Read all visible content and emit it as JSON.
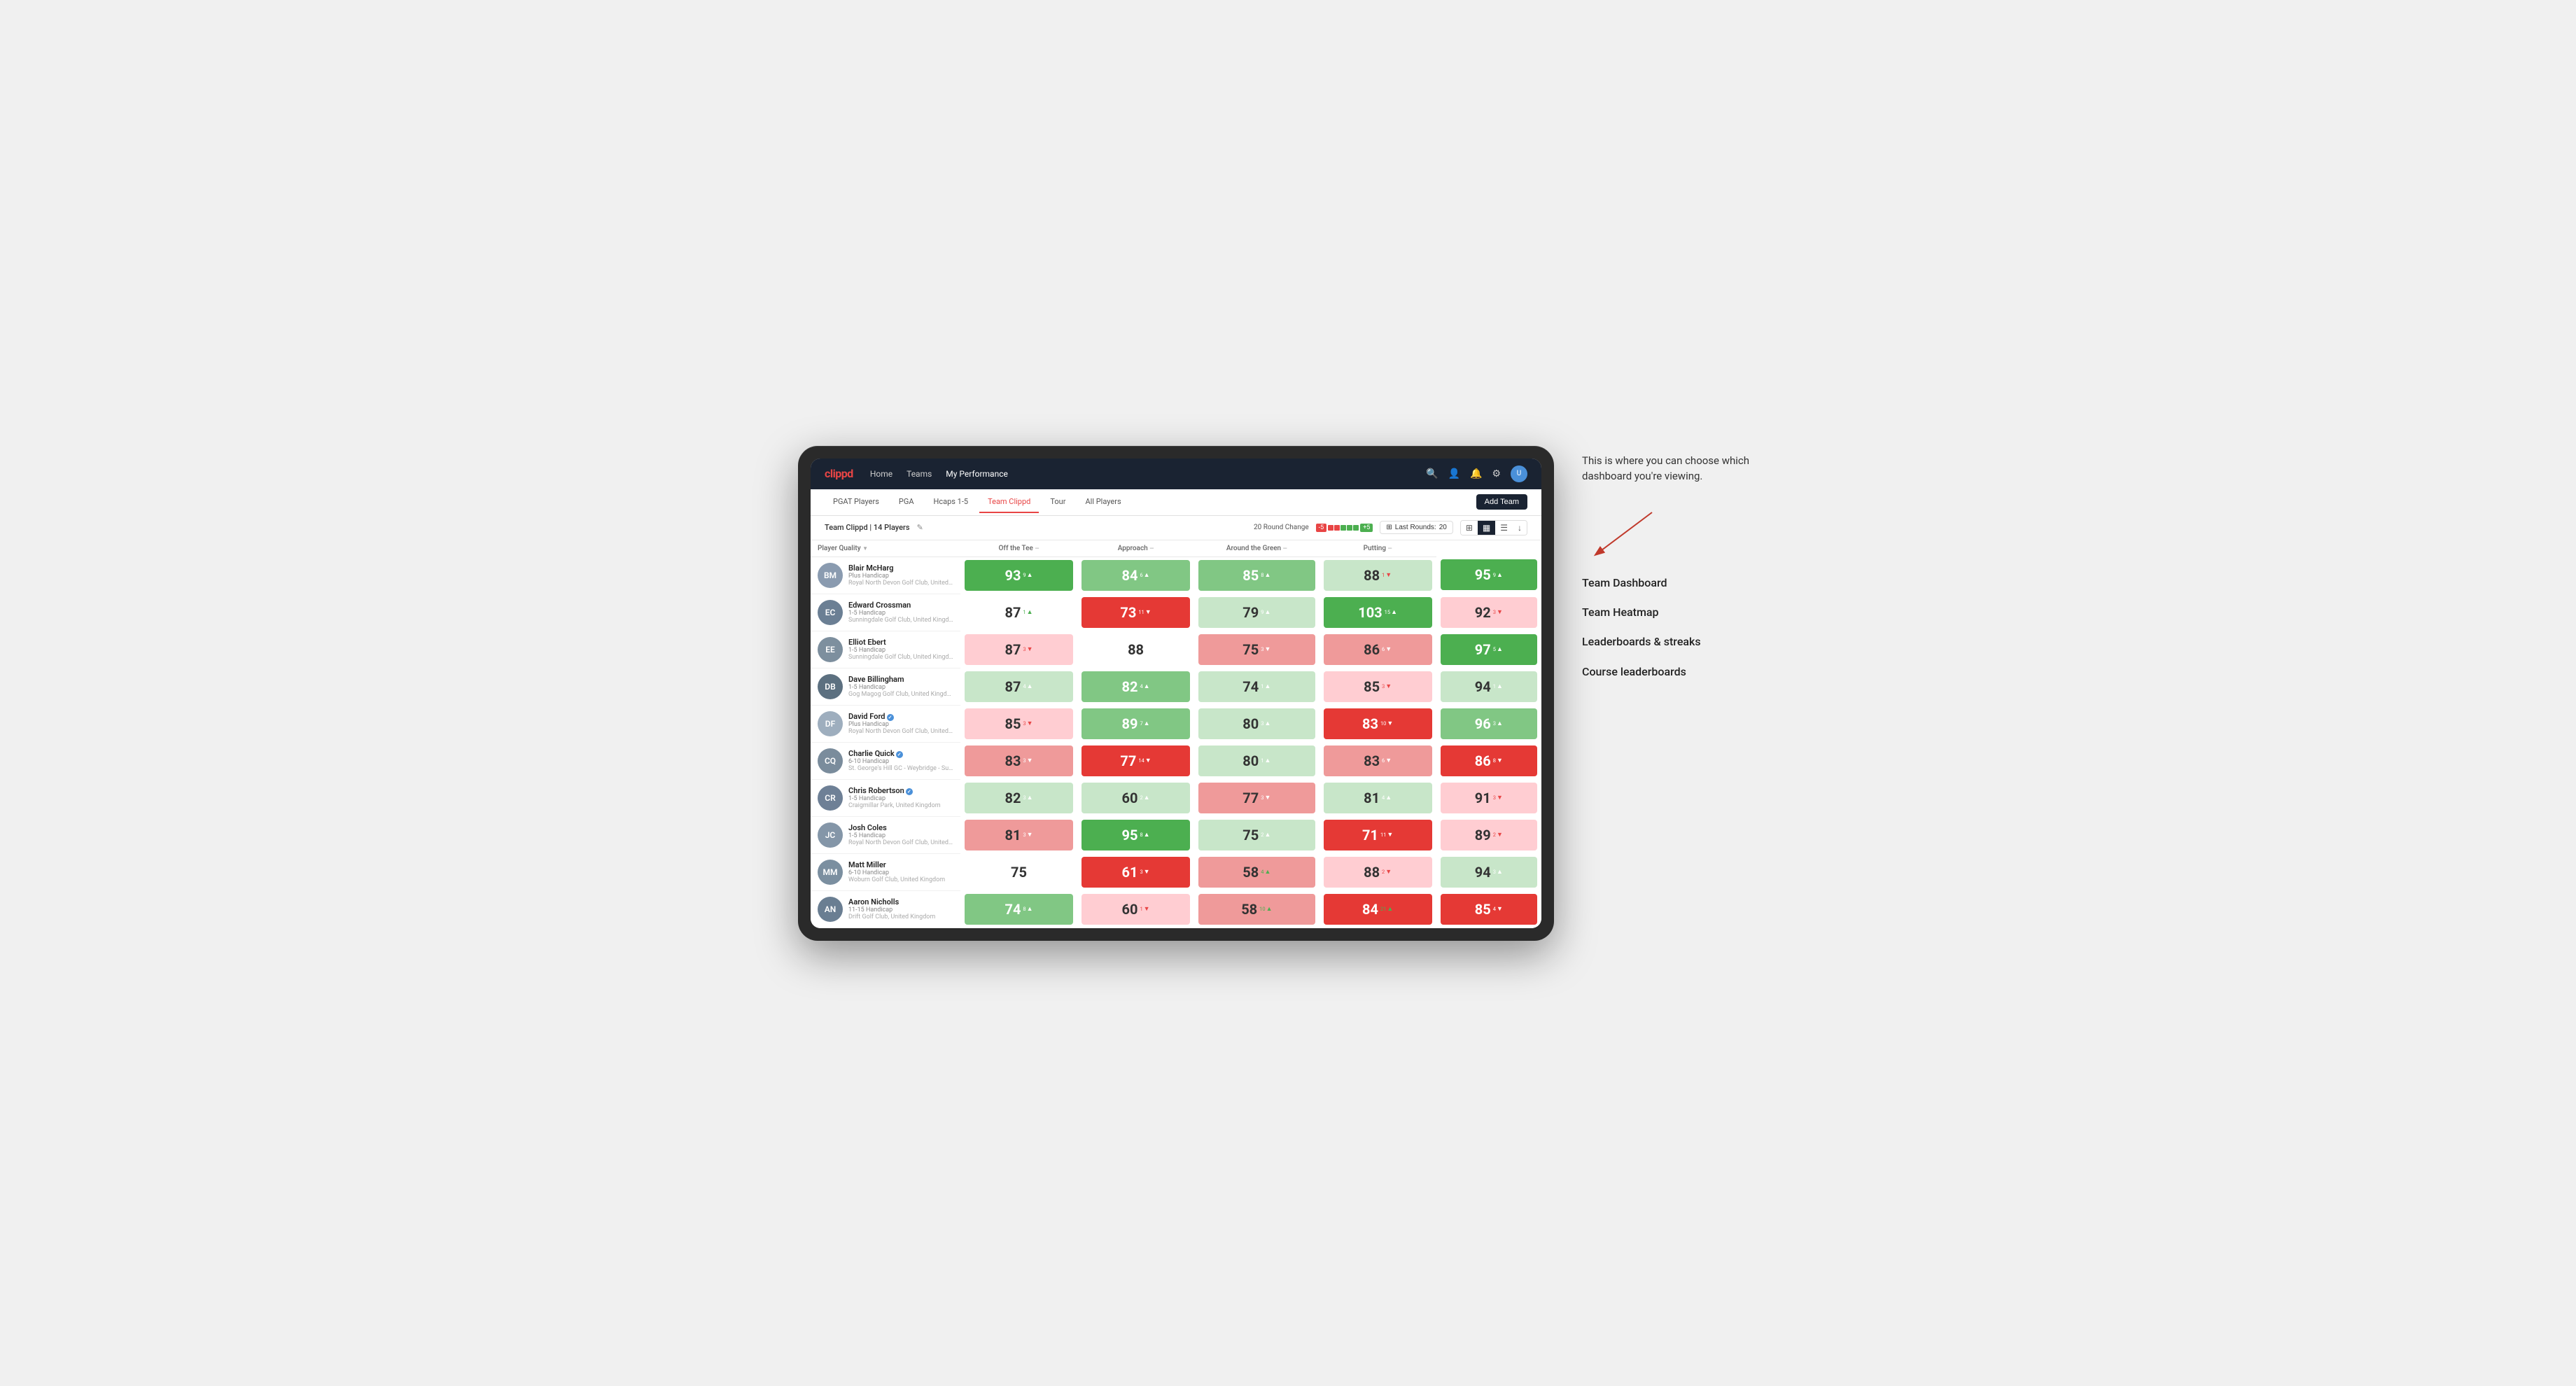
{
  "annotation": {
    "intro_text": "This is where you can choose which dashboard you're viewing.",
    "items": [
      "Team Dashboard",
      "Team Heatmap",
      "Leaderboards & streaks",
      "Course leaderboards"
    ]
  },
  "nav": {
    "logo": "clippd",
    "links": [
      "Home",
      "Teams",
      "My Performance"
    ],
    "active_link": "My Performance"
  },
  "sub_nav": {
    "tabs": [
      "PGAT Players",
      "PGA",
      "Hcaps 1-5",
      "Team Clippd",
      "Tour",
      "All Players"
    ],
    "active_tab": "Team Clippd",
    "add_team_label": "Add Team"
  },
  "team_bar": {
    "team_name": "Team Clippd",
    "player_count": "14 Players",
    "round_change_label": "20 Round Change",
    "neg_value": "-5",
    "pos_value": "+5",
    "last_rounds_label": "Last Rounds:",
    "last_rounds_value": "20"
  },
  "table": {
    "columns": [
      {
        "label": "Player Quality",
        "sort": true
      },
      {
        "label": "Off the Tee",
        "sort": true
      },
      {
        "label": "Approach",
        "sort": true
      },
      {
        "label": "Around the Green",
        "sort": true
      },
      {
        "label": "Putting",
        "sort": true
      }
    ],
    "players": [
      {
        "name": "Blair McHarg",
        "handicap": "Plus Handicap",
        "club": "Royal North Devon Golf Club, United Kingdom",
        "initials": "BM",
        "scores": [
          {
            "value": "93",
            "change": "9",
            "dir": "up",
            "bg": "green-strong"
          },
          {
            "value": "84",
            "change": "6",
            "dir": "up",
            "bg": "green-medium"
          },
          {
            "value": "85",
            "change": "8",
            "dir": "up",
            "bg": "green-medium"
          },
          {
            "value": "88",
            "change": "1",
            "dir": "down",
            "bg": "green-light"
          },
          {
            "value": "95",
            "change": "9",
            "dir": "up",
            "bg": "green-strong"
          }
        ]
      },
      {
        "name": "Edward Crossman",
        "handicap": "1-5 Handicap",
        "club": "Sunningdale Golf Club, United Kingdom",
        "initials": "EC",
        "scores": [
          {
            "value": "87",
            "change": "1",
            "dir": "up",
            "bg": "white"
          },
          {
            "value": "73",
            "change": "11",
            "dir": "down",
            "bg": "red-strong"
          },
          {
            "value": "79",
            "change": "9",
            "dir": "up",
            "bg": "green-light"
          },
          {
            "value": "103",
            "change": "15",
            "dir": "up",
            "bg": "green-strong"
          },
          {
            "value": "92",
            "change": "3",
            "dir": "down",
            "bg": "red-light"
          }
        ]
      },
      {
        "name": "Elliot Ebert",
        "handicap": "1-5 Handicap",
        "club": "Sunningdale Golf Club, United Kingdom",
        "initials": "EE",
        "scores": [
          {
            "value": "87",
            "change": "3",
            "dir": "down",
            "bg": "red-light"
          },
          {
            "value": "88",
            "change": "",
            "dir": "",
            "bg": "white"
          },
          {
            "value": "75",
            "change": "3",
            "dir": "down",
            "bg": "red-medium"
          },
          {
            "value": "86",
            "change": "6",
            "dir": "down",
            "bg": "red-medium"
          },
          {
            "value": "97",
            "change": "5",
            "dir": "up",
            "bg": "green-strong"
          }
        ]
      },
      {
        "name": "Dave Billingham",
        "handicap": "1-5 Handicap",
        "club": "Gog Magog Golf Club, United Kingdom",
        "initials": "DB",
        "scores": [
          {
            "value": "87",
            "change": "4",
            "dir": "up",
            "bg": "green-light"
          },
          {
            "value": "82",
            "change": "4",
            "dir": "up",
            "bg": "green-medium"
          },
          {
            "value": "74",
            "change": "1",
            "dir": "up",
            "bg": "green-light"
          },
          {
            "value": "85",
            "change": "3",
            "dir": "down",
            "bg": "red-light"
          },
          {
            "value": "94",
            "change": "1",
            "dir": "up",
            "bg": "green-light"
          }
        ]
      },
      {
        "name": "David Ford",
        "handicap": "Plus Handicap",
        "club": "Royal North Devon Golf Club, United Kingdom",
        "initials": "DF",
        "verified": true,
        "scores": [
          {
            "value": "85",
            "change": "3",
            "dir": "down",
            "bg": "red-light"
          },
          {
            "value": "89",
            "change": "7",
            "dir": "up",
            "bg": "green-medium"
          },
          {
            "value": "80",
            "change": "3",
            "dir": "up",
            "bg": "green-light"
          },
          {
            "value": "83",
            "change": "10",
            "dir": "down",
            "bg": "red-strong"
          },
          {
            "value": "96",
            "change": "3",
            "dir": "up",
            "bg": "green-medium"
          }
        ]
      },
      {
        "name": "Charlie Quick",
        "handicap": "6-10 Handicap",
        "club": "St. George's Hill GC - Weybridge - Surrey, Uni...",
        "initials": "CQ",
        "verified": true,
        "scores": [
          {
            "value": "83",
            "change": "3",
            "dir": "down",
            "bg": "red-medium"
          },
          {
            "value": "77",
            "change": "14",
            "dir": "down",
            "bg": "red-strong"
          },
          {
            "value": "80",
            "change": "1",
            "dir": "up",
            "bg": "green-light"
          },
          {
            "value": "83",
            "change": "6",
            "dir": "down",
            "bg": "red-medium"
          },
          {
            "value": "86",
            "change": "8",
            "dir": "down",
            "bg": "red-strong"
          }
        ]
      },
      {
        "name": "Chris Robertson",
        "handicap": "1-5 Handicap",
        "club": "Craigmillar Park, United Kingdom",
        "initials": "CR",
        "verified": true,
        "scores": [
          {
            "value": "82",
            "change": "3",
            "dir": "up",
            "bg": "green-light"
          },
          {
            "value": "60",
            "change": "2",
            "dir": "up",
            "bg": "green-light"
          },
          {
            "value": "77",
            "change": "3",
            "dir": "down",
            "bg": "red-medium"
          },
          {
            "value": "81",
            "change": "4",
            "dir": "up",
            "bg": "green-light"
          },
          {
            "value": "91",
            "change": "3",
            "dir": "down",
            "bg": "red-light"
          }
        ]
      },
      {
        "name": "Josh Coles",
        "handicap": "1-5 Handicap",
        "club": "Royal North Devon Golf Club, United Kingdom",
        "initials": "JC",
        "scores": [
          {
            "value": "81",
            "change": "3",
            "dir": "down",
            "bg": "red-medium"
          },
          {
            "value": "95",
            "change": "8",
            "dir": "up",
            "bg": "green-strong"
          },
          {
            "value": "75",
            "change": "2",
            "dir": "up",
            "bg": "green-light"
          },
          {
            "value": "71",
            "change": "11",
            "dir": "down",
            "bg": "red-strong"
          },
          {
            "value": "89",
            "change": "2",
            "dir": "down",
            "bg": "red-light"
          }
        ]
      },
      {
        "name": "Matt Miller",
        "handicap": "6-10 Handicap",
        "club": "Woburn Golf Club, United Kingdom",
        "initials": "MM",
        "scores": [
          {
            "value": "75",
            "change": "",
            "dir": "",
            "bg": "white"
          },
          {
            "value": "61",
            "change": "3",
            "dir": "down",
            "bg": "red-strong"
          },
          {
            "value": "58",
            "change": "4",
            "dir": "up",
            "bg": "red-medium"
          },
          {
            "value": "88",
            "change": "2",
            "dir": "down",
            "bg": "red-light"
          },
          {
            "value": "94",
            "change": "3",
            "dir": "up",
            "bg": "green-light"
          }
        ]
      },
      {
        "name": "Aaron Nicholls",
        "handicap": "11-15 Handicap",
        "club": "Drift Golf Club, United Kingdom",
        "initials": "AN",
        "scores": [
          {
            "value": "74",
            "change": "8",
            "dir": "up",
            "bg": "green-medium"
          },
          {
            "value": "60",
            "change": "1",
            "dir": "down",
            "bg": "red-light"
          },
          {
            "value": "58",
            "change": "10",
            "dir": "up",
            "bg": "red-medium"
          },
          {
            "value": "84",
            "change": "21",
            "dir": "up",
            "bg": "red-strong"
          },
          {
            "value": "85",
            "change": "4",
            "dir": "down",
            "bg": "red-strong"
          }
        ]
      }
    ]
  },
  "colors": {
    "nav_bg": "#1a2332",
    "accent": "#e84545",
    "green_strong": "#4caf50",
    "green_medium": "#81c784",
    "green_light": "#c8e6c9",
    "red_light": "#ffcdd2",
    "red_medium": "#ef9a9a",
    "red_strong": "#e53935"
  }
}
